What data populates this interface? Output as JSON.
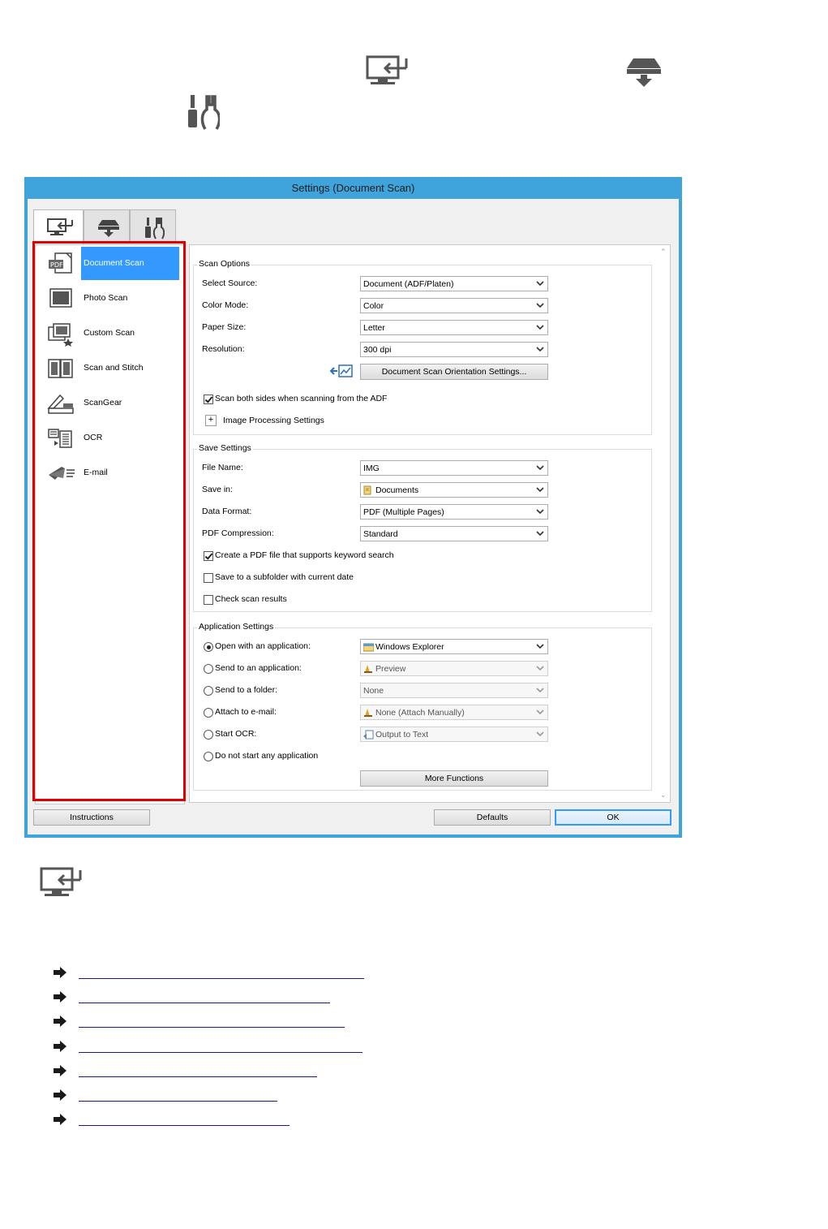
{
  "top_icons": [
    {
      "name": "scan-from-computer-icon"
    },
    {
      "name": "scan-from-operation-panel-icon"
    },
    {
      "name": "general-settings-icon"
    }
  ],
  "dialog": {
    "title": "Settings (Document Scan)",
    "tabs": [
      {
        "name": "scan-from-computer-tab",
        "icon": "computer-arrow-icon",
        "active": true
      },
      {
        "name": "scan-from-panel-tab",
        "icon": "scanner-down-icon",
        "active": false
      },
      {
        "name": "general-settings-tab",
        "icon": "tools-icon",
        "active": false
      }
    ],
    "sidebar": {
      "items": [
        {
          "label": "Document Scan",
          "icon": "pdf-document-icon",
          "selected": true
        },
        {
          "label": "Photo Scan",
          "icon": "photo-icon",
          "selected": false
        },
        {
          "label": "Custom Scan",
          "icon": "custom-scan-icon",
          "selected": false
        },
        {
          "label": "Scan and Stitch",
          "icon": "stitch-icon",
          "selected": false
        },
        {
          "label": "ScanGear",
          "icon": "scangear-icon",
          "selected": false
        },
        {
          "label": "OCR",
          "icon": "ocr-icon",
          "selected": false
        },
        {
          "label": "E-mail",
          "icon": "email-icon",
          "selected": false
        }
      ],
      "highlight_color": "#e00000"
    },
    "scan_options": {
      "title": "Scan Options",
      "select_source": {
        "label": "Select Source:",
        "value": "Document (ADF/Platen)"
      },
      "color_mode": {
        "label": "Color Mode:",
        "value": "Color"
      },
      "paper_size": {
        "label": "Paper Size:",
        "value": "Letter"
      },
      "resolution": {
        "label": "Resolution:",
        "value": "300 dpi"
      },
      "orientation_button": "Document Scan Orientation Settings...",
      "scan_both_sides": {
        "label": "Scan both sides when scanning from the ADF",
        "checked": true
      },
      "image_processing": {
        "label": "Image Processing Settings",
        "expander": "+"
      }
    },
    "save_settings": {
      "title": "Save Settings",
      "file_name": {
        "label": "File Name:",
        "value": "IMG"
      },
      "save_in": {
        "label": "Save in:",
        "value": "Documents"
      },
      "data_format": {
        "label": "Data Format:",
        "value": "PDF (Multiple Pages)"
      },
      "pdf_compression": {
        "label": "PDF Compression:",
        "value": "Standard"
      },
      "keyword_search": {
        "label": "Create a PDF file that supports keyword search",
        "checked": true
      },
      "subfolder": {
        "label": "Save to a subfolder with current date",
        "checked": false
      },
      "check_results": {
        "label": "Check scan results",
        "checked": false
      }
    },
    "application_settings": {
      "title": "Application Settings",
      "open_with": {
        "label": "Open with an application:",
        "value": "Windows Explorer",
        "selected": true
      },
      "send_to_app": {
        "label": "Send to an application:",
        "value": "Preview",
        "selected": false
      },
      "send_to_folder": {
        "label": "Send to a folder:",
        "value": "None",
        "selected": false
      },
      "attach_email": {
        "label": "Attach to e-mail:",
        "value": "None (Attach Manually)",
        "selected": false
      },
      "start_ocr": {
        "label": "Start OCR:",
        "value": "Output to Text",
        "selected": false
      },
      "no_app": {
        "label": "Do not start any application",
        "selected": false
      },
      "more_functions": "More Functions"
    },
    "footer": {
      "instructions": "Instructions",
      "defaults": "Defaults",
      "ok": "OK"
    }
  },
  "bottom_icon": {
    "name": "scan-from-computer-icon"
  },
  "links": {
    "count": 7,
    "arrow_icon": "right-arrow-icon"
  }
}
